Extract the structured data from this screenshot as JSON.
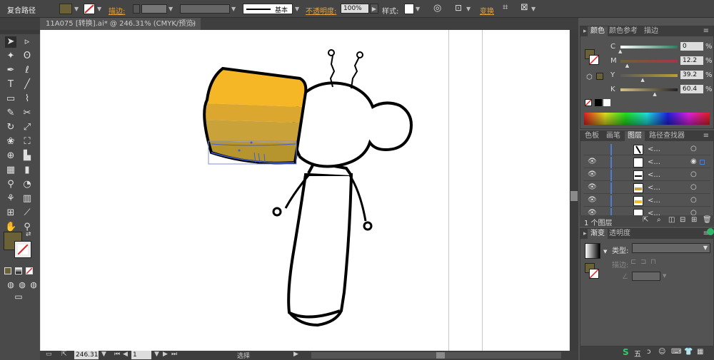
{
  "control_bar": {
    "object_type": "复合路径",
    "stroke_label": "描边:",
    "stroke_style": "基本",
    "opacity_label": "不透明度:",
    "opacity_value": "100%",
    "style_label": "样式:",
    "transform_label": "变换"
  },
  "document_tab": {
    "title": "11A075 [转换].ai* @ 246.31% (CMYK/预览)",
    "close": "×"
  },
  "color_panel": {
    "tabs": [
      "颜色",
      "颜色参考",
      "描边"
    ],
    "channels": [
      {
        "label": "C",
        "value": "0",
        "percent": "%",
        "level": 0,
        "color": "#2e7a5e"
      },
      {
        "label": "M",
        "value": "12.2",
        "percent": "%",
        "level": 12.2,
        "color": "#a8344a"
      },
      {
        "label": "Y",
        "value": "39.2",
        "percent": "%",
        "level": 39.2,
        "color": "#b8a030"
      },
      {
        "label": "K",
        "value": "60.4",
        "percent": "%",
        "level": 60.4,
        "color": "#404040"
      }
    ],
    "fill_color": "#6b6138"
  },
  "layers_panel": {
    "tabs": [
      "色板",
      "画笔",
      "图层",
      "路径查找器"
    ],
    "row_label": "<...",
    "footer_text": "1 个图层"
  },
  "gradient_panel": {
    "tabs": [
      "渐变",
      "透明度"
    ],
    "type_label": "类型:",
    "stroke_label": "描边:"
  },
  "status_bar": {
    "zoom": "246.31",
    "page": "1",
    "tool": "选择"
  },
  "taskbar": {
    "text": "五"
  },
  "artwork": {
    "cup_gold": "#f6b727",
    "cup_mid": "#dba72f",
    "cup_dark": "#c9a23a",
    "cup_bottom": "#b6952f"
  }
}
